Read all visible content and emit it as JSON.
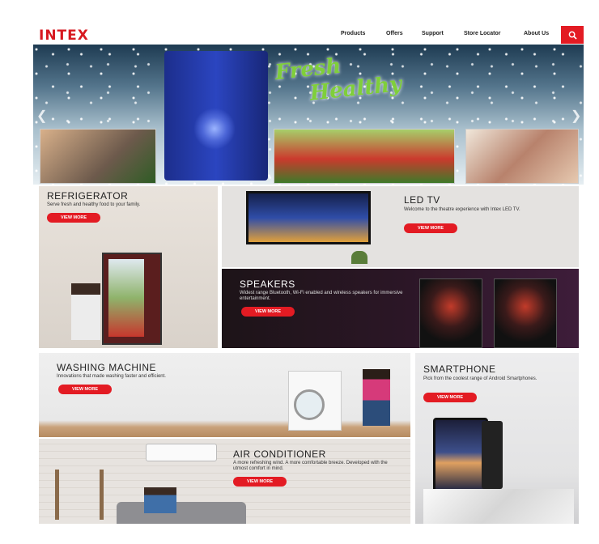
{
  "header": {
    "logo": "INTEX",
    "nav": [
      "Products",
      "Offers",
      "Support",
      "Store Locator",
      "About Us"
    ],
    "search_icon": "search-icon"
  },
  "hero": {
    "headline_1": "Fresh",
    "headline_2": "Healthy",
    "prev_icon": "chevron-left-icon",
    "next_icon": "chevron-right-icon"
  },
  "tiles": {
    "refrigerator": {
      "title": "REFRIGERATOR",
      "desc": "Serve fresh and healthy food to your family.",
      "button": "VIEW MORE"
    },
    "led_tv": {
      "title": "LED TV",
      "desc": "Welcome to the theatre experience with Intex LED TV.",
      "button": "VIEW MORE"
    },
    "speakers": {
      "title": "SPEAKERS",
      "desc": "Widest range Bluetooth, Wi-Fi enabled and wireless speakers for immersive entertainment.",
      "button": "VIEW MORE"
    },
    "washing_machine": {
      "title": "WASHING MACHINE",
      "desc": "Innovations that made washing faster and efficient.",
      "button": "VIEW MORE"
    },
    "smartphone": {
      "title": "SMARTPHONE",
      "desc": "Pick from the coolest range of Android Smartphones.",
      "button": "VIEW MORE"
    },
    "air_conditioner": {
      "title": "AIR CONDITIONER",
      "desc": "A more refreshing wind. A more comfortable breeze. Developed with the utmost comfort in mind.",
      "button": "VIEW MORE"
    }
  },
  "colors": {
    "brand": "#e31b23"
  }
}
